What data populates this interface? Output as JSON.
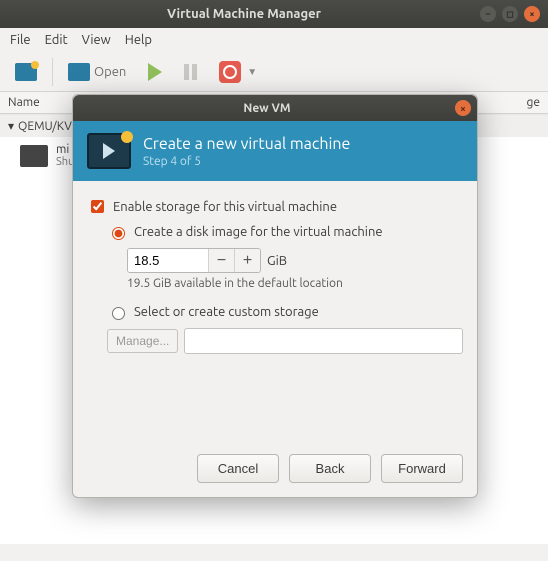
{
  "window": {
    "title": "Virtual Machine Manager"
  },
  "menubar": {
    "file": "File",
    "edit": "Edit",
    "view": "View",
    "help": "Help"
  },
  "toolbar": {
    "open_label": "Open"
  },
  "list": {
    "header_name": "Name",
    "header_usage": "ge",
    "group": "QEMU/KV",
    "vm_name": "mi",
    "vm_state": "Shu"
  },
  "dialog": {
    "title": "New VM",
    "header_title": "Create a new virtual machine",
    "step": "Step 4 of 5",
    "enable_storage": "Enable storage for this virtual machine",
    "create_disk": "Create a disk image for the virtual machine",
    "size_value": "18.5",
    "size_unit": "GiB",
    "available": "19.5 GiB available in the default location",
    "custom_storage": "Select or create custom storage",
    "manage": "Manage...",
    "cancel": "Cancel",
    "back": "Back",
    "forward": "Forward"
  }
}
